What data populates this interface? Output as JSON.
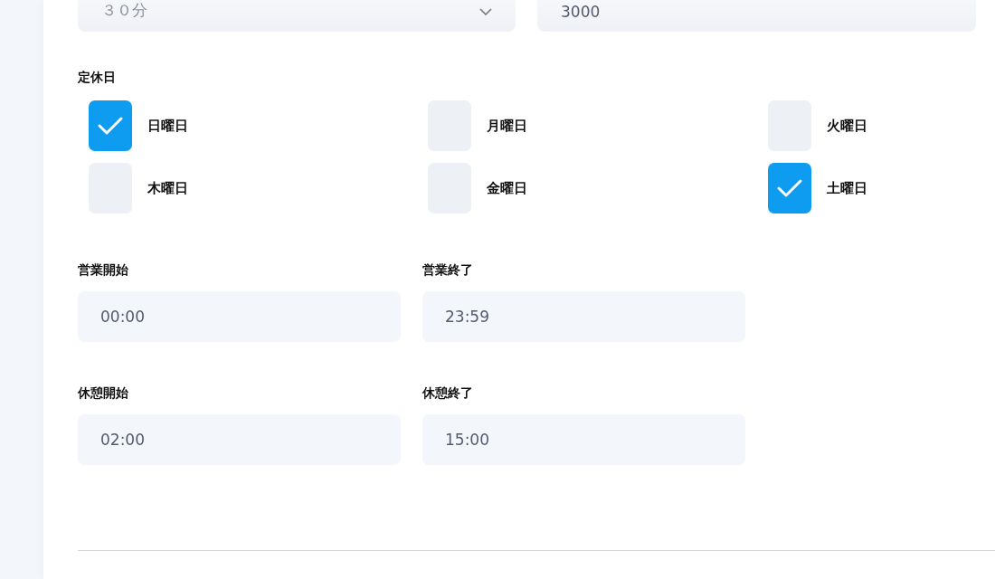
{
  "top_fields": [
    {
      "kind": "select",
      "value": "３０分"
    },
    {
      "kind": "input",
      "value": "3000"
    }
  ],
  "holidays": {
    "label": "定休日",
    "days": [
      {
        "label": "日曜日",
        "checked": true
      },
      {
        "label": "月曜日",
        "checked": false
      },
      {
        "label": "火曜日",
        "checked": false
      },
      {
        "label": "木曜日",
        "checked": false
      },
      {
        "label": "金曜日",
        "checked": false
      },
      {
        "label": "土曜日",
        "checked": true
      }
    ]
  },
  "time_fields": [
    {
      "label": "営業開始",
      "value": "00:00"
    },
    {
      "label": "営業終了",
      "value": "23:59"
    },
    {
      "label": "休憩開始",
      "value": "02:00"
    },
    {
      "label": "休憩終了",
      "value": "15:00"
    }
  ]
}
